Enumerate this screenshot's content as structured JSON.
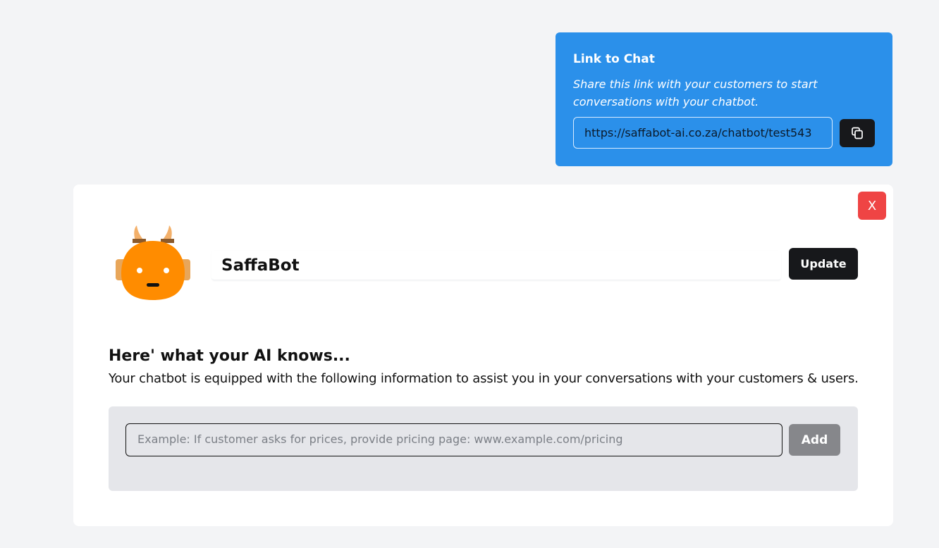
{
  "link_card": {
    "title": "Link to Chat",
    "description": "Share this link with your customers to start conversations with your chatbot.",
    "url": "https://saffabot-ai.co.za/chatbot/test543",
    "copy_icon": "copy-icon"
  },
  "bot_card": {
    "close_label": "X",
    "bot_name": "SaffaBot",
    "update_label": "Update",
    "avatar_icon": "robot-avatar-icon",
    "knows_title": "Here' what your AI knows...",
    "knows_description": "Your chatbot is equipped with the following information to assist you in your conversations with your customers & users.",
    "knowledge_placeholder": "Example: If customer asks for prices, provide pricing page: www.example.com/pricing",
    "add_label": "Add"
  },
  "colors": {
    "link_card_bg": "#2b90ea",
    "close_button_bg": "#ef4444",
    "dark_button_bg": "#17181b",
    "add_button_bg": "#86878b",
    "avatar_orange": "#ff8c00"
  }
}
